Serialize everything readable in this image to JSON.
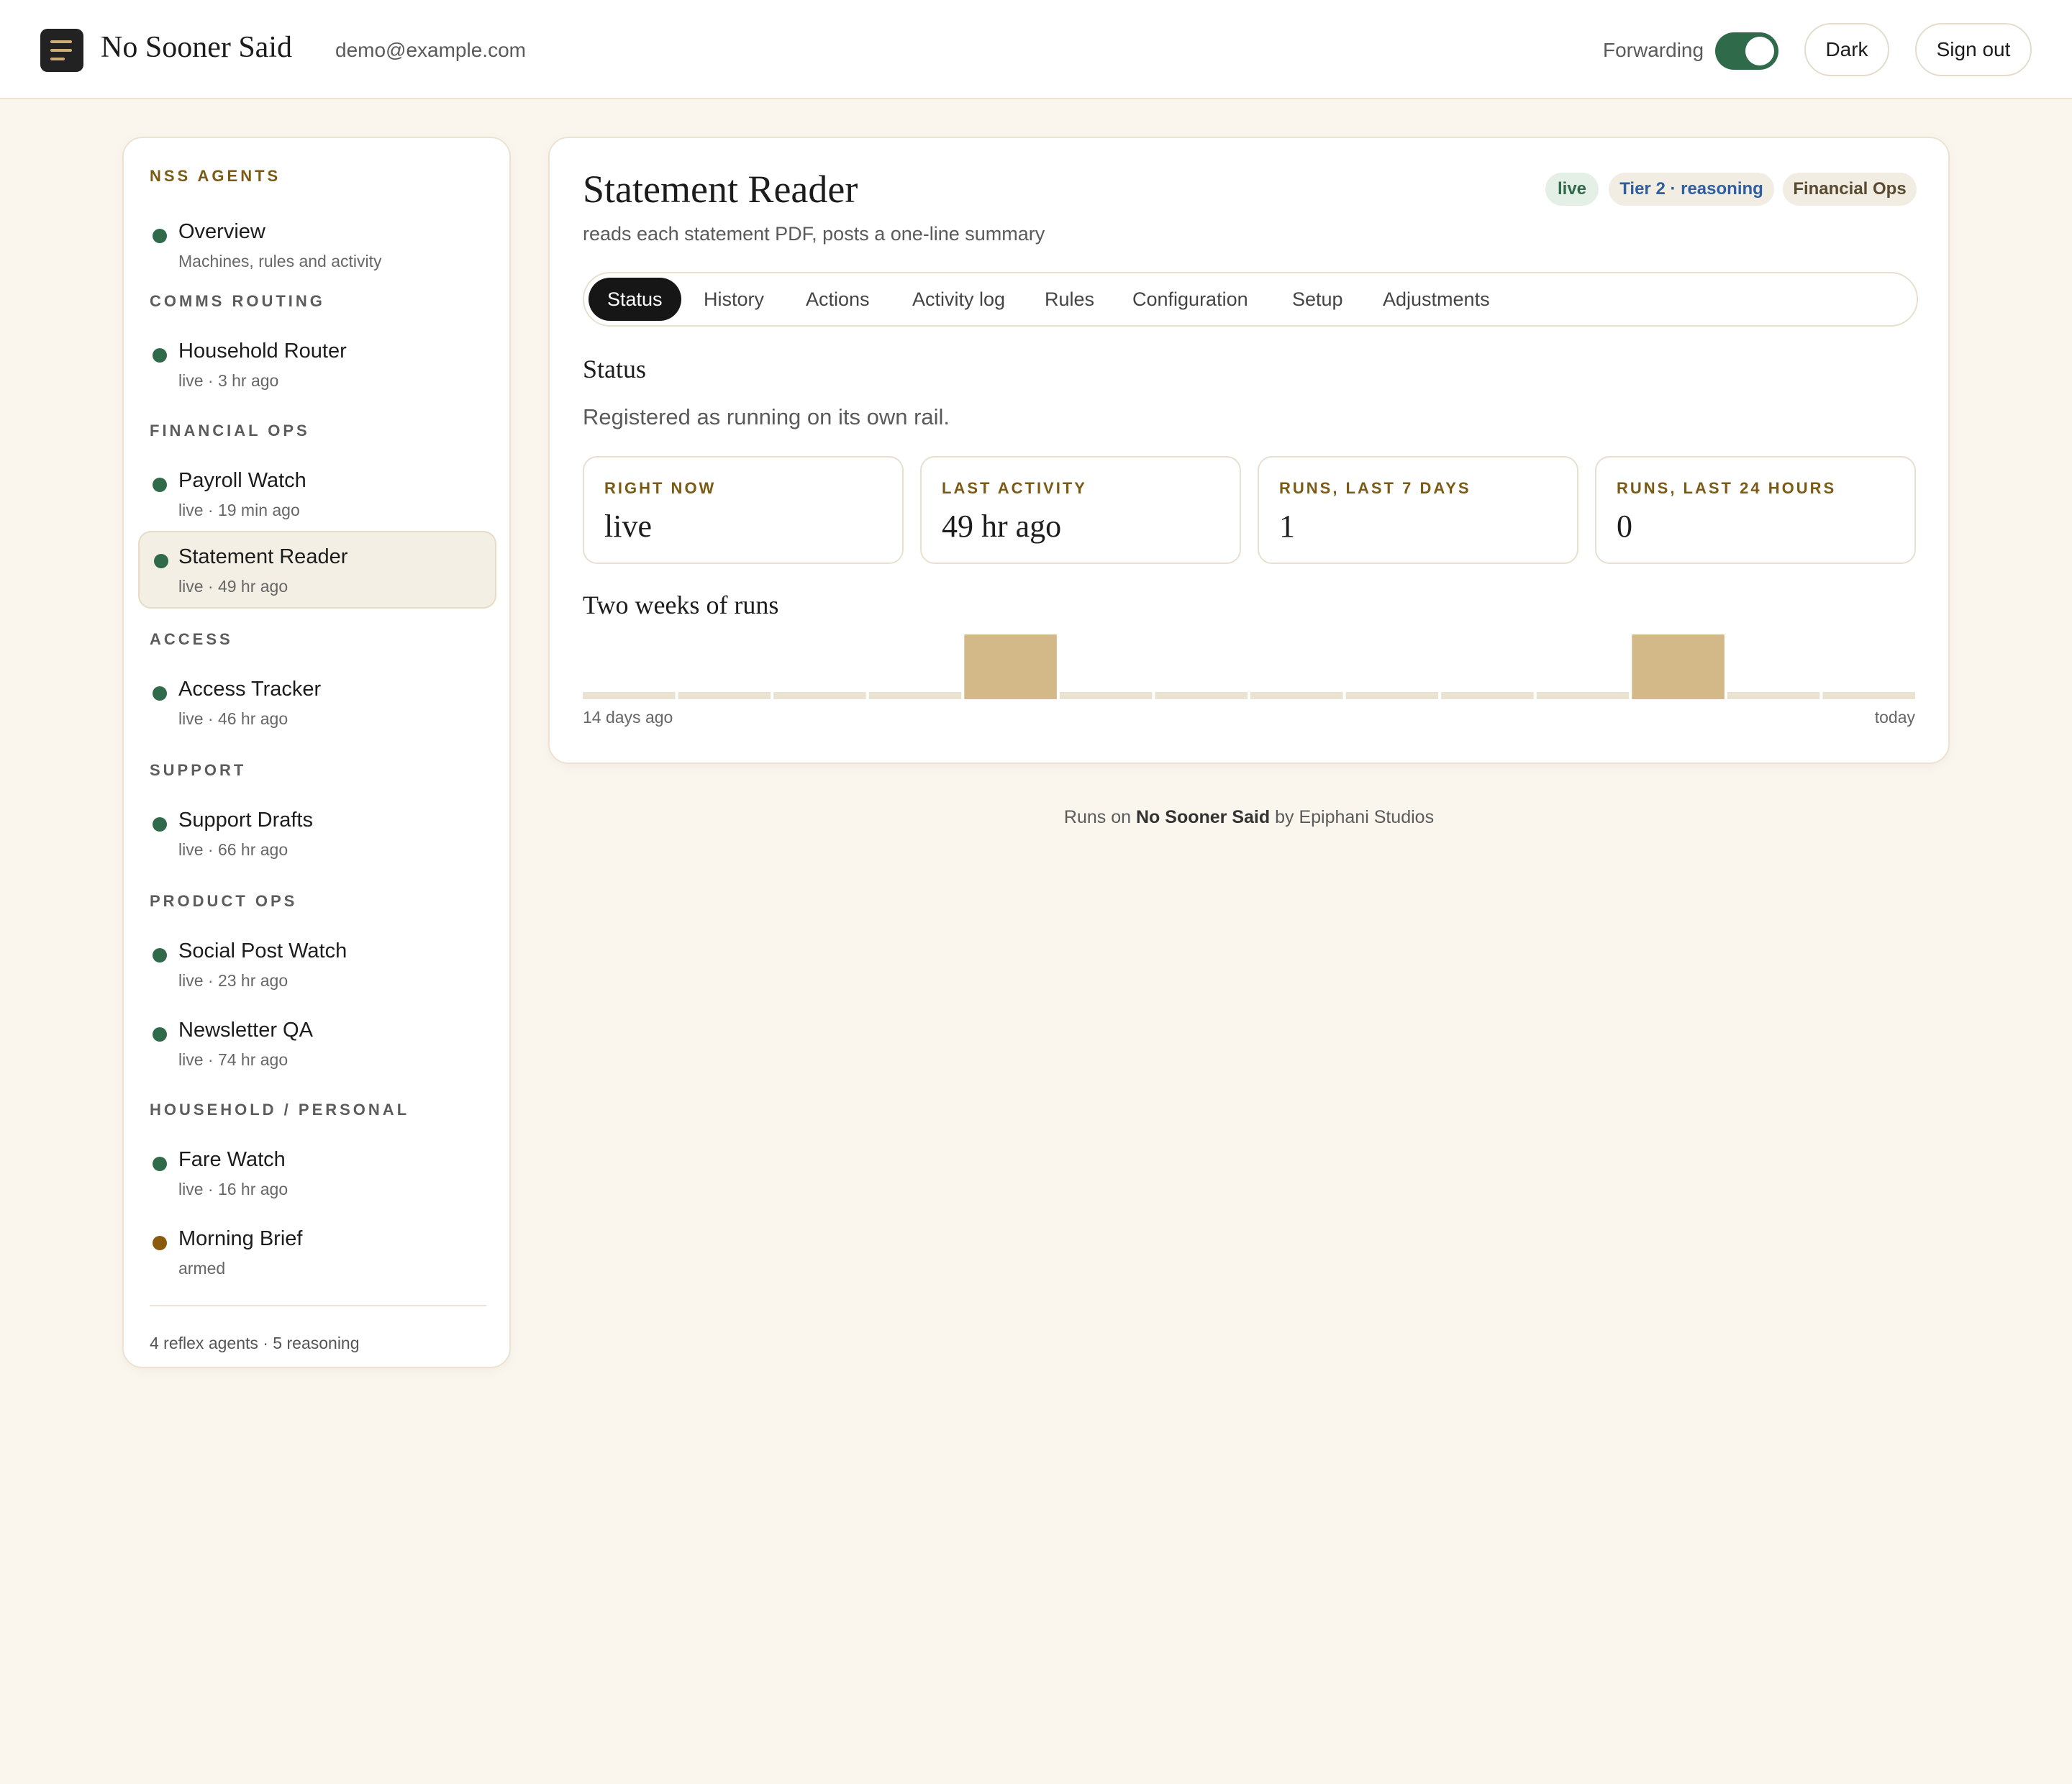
{
  "app": {
    "brand": "No Sooner Said",
    "email": "demo@example.com",
    "forwarding_label": "Forwarding",
    "forwarding_on": true,
    "dark_label": "Dark",
    "signout_label": "Sign out"
  },
  "sidebar": {
    "header": "NSS AGENTS",
    "overview": {
      "name": "Overview",
      "sub": "Machines, rules and activity"
    },
    "sections": {
      "comms": "COMMS ROUTING",
      "financial": "FINANCIAL OPS",
      "access": "ACCESS",
      "support": "SUPPORT",
      "product": "PRODUCT OPS",
      "household": "HOUSEHOLD / PERSONAL"
    },
    "agents": [
      {
        "name": "Household Router",
        "sub": "live · 3 hr ago"
      },
      {
        "name": "Payroll Watch",
        "sub": "live · 19 min ago"
      },
      {
        "name": "Statement Reader",
        "sub": "live · 49 hr ago"
      },
      {
        "name": "Access Tracker",
        "sub": "live · 46 hr ago"
      },
      {
        "name": "Support Drafts",
        "sub": "live · 66 hr ago"
      },
      {
        "name": "Social Post Watch",
        "sub": "live · 23 hr ago"
      },
      {
        "name": "Newsletter QA",
        "sub": "live · 74 hr ago"
      },
      {
        "name": "Fare Watch",
        "sub": "live · 16 hr ago"
      },
      {
        "name": "Morning Brief",
        "sub": "armed"
      }
    ],
    "footer": "4 reflex agents · 5 reasoning"
  },
  "main": {
    "title": "Statement Reader",
    "description": "reads each statement PDF, posts a one-line summary",
    "badges": {
      "live": "live",
      "tier": "Tier 2 · reasoning",
      "ops": "Financial Ops"
    },
    "tabs": [
      "Status",
      "History",
      "Actions",
      "Activity log",
      "Rules",
      "Configuration",
      "Setup",
      "Adjustments"
    ],
    "active_tab": "Status",
    "status_heading": "Status",
    "status_text": "Registered as running on its own rail.",
    "stats": [
      {
        "label": "RIGHT NOW",
        "value": "live"
      },
      {
        "label": "LAST ACTIVITY",
        "value": "49 hr ago"
      },
      {
        "label": "RUNS, LAST 7 DAYS",
        "value": "1"
      },
      {
        "label": "RUNS, LAST 24 HOURS",
        "value": "0"
      }
    ],
    "chart_heading": "Two weeks of runs",
    "axis_left": "14 days ago",
    "axis_right": "today"
  },
  "chart_data": {
    "type": "bar",
    "values": [
      0,
      0,
      0,
      0,
      1,
      0,
      0,
      0,
      0,
      0,
      0,
      1,
      0,
      0
    ],
    "xlabel_start": "14 days ago",
    "xlabel_end": "today",
    "bar_color": "#d3b988",
    "empty_color": "#ebe3d2"
  },
  "colors": {
    "accent_green": "#2f6b4a",
    "accent_gold": "#7a5a14",
    "amber_dot": "#8a5a10",
    "background": "#faf6ee"
  },
  "page_footer": {
    "prefix": "Runs on",
    "brand": "No Sooner Said",
    "suffix": "by Epiphani Studios"
  }
}
